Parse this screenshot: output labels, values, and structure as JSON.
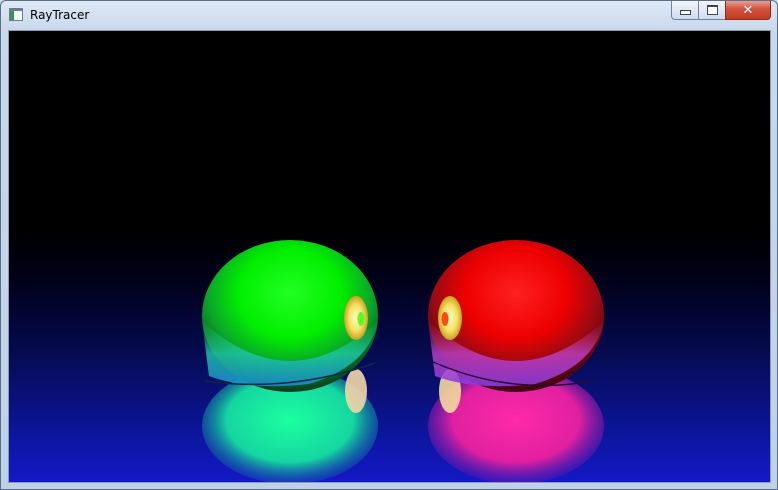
{
  "window": {
    "title": "RayTracer",
    "icon": "app-window-icon",
    "buttons": {
      "minimize_icon": "minimize-icon",
      "maximize_icon": "maximize-icon",
      "close_label": "✕"
    }
  },
  "scene": {
    "background_top": "#000000",
    "floor_bottom": "#1418c8",
    "spheres": [
      {
        "name": "green-sphere",
        "color": "#00ff00"
      },
      {
        "name": "red-sphere",
        "color": "#ff0000"
      }
    ]
  }
}
